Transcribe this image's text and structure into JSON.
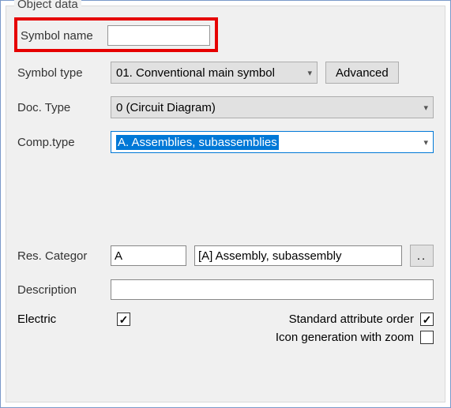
{
  "groupTitle": "Object data",
  "symbolName": {
    "label": "Symbol name",
    "value": ""
  },
  "symbolType": {
    "label": "Symbol type",
    "selected": "01. Conventional main symbol",
    "advanced": "Advanced"
  },
  "docType": {
    "label": "Doc. Type",
    "selected": "0 (Circuit Diagram)"
  },
  "compType": {
    "label": "Comp.type",
    "selected": "A. Assemblies, subassemblies"
  },
  "resCateg": {
    "label": "Res. Categor",
    "code": "A",
    "desc": "[A] Assembly, subassembly",
    "browse": ".."
  },
  "description": {
    "label": "Description",
    "value": ""
  },
  "electric": {
    "label": "Electric",
    "checked": true
  },
  "stdAttr": {
    "label": "Standard attribute order",
    "checked": true
  },
  "iconGen": {
    "label": "Icon generation with zoom",
    "checked": false
  }
}
